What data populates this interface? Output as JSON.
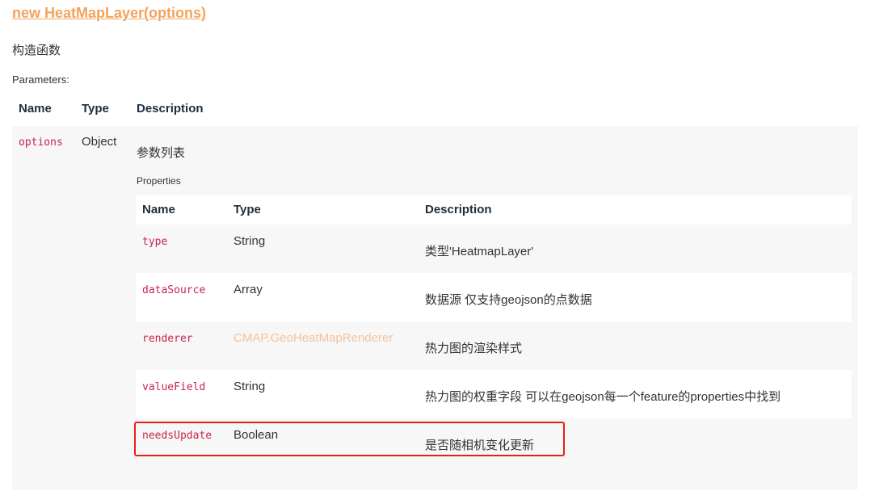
{
  "signature": "new HeatMapLayer(options)",
  "description": "构造函数",
  "parameters_label": "Parameters:",
  "headers": {
    "name": "Name",
    "type": "Type",
    "description": "Description"
  },
  "param": {
    "name": "options",
    "type": "Object",
    "description": "参数列表",
    "properties_label": "Properties",
    "properties": [
      {
        "name": "type",
        "type": "String",
        "description": "类型'HeatmapLayer'"
      },
      {
        "name": "dataSource",
        "type": "Array",
        "description": "数据源 仅支持geojson的点数据"
      },
      {
        "name": "renderer",
        "type": "CMAP.GeoHeatMapRenderer",
        "description": "热力图的渲染样式"
      },
      {
        "name": "valueField",
        "type": "String",
        "description": "热力图的权重字段 可以在geojson每一个feature的properties中找到"
      },
      {
        "name": "needsUpdate",
        "type": "Boolean",
        "description": "是否随相机变化更新"
      }
    ]
  },
  "colors": {
    "signature": "#f3a35c",
    "code": "#c7254e",
    "link_type": "#f5c29b",
    "highlight_border": "#e8201a"
  }
}
